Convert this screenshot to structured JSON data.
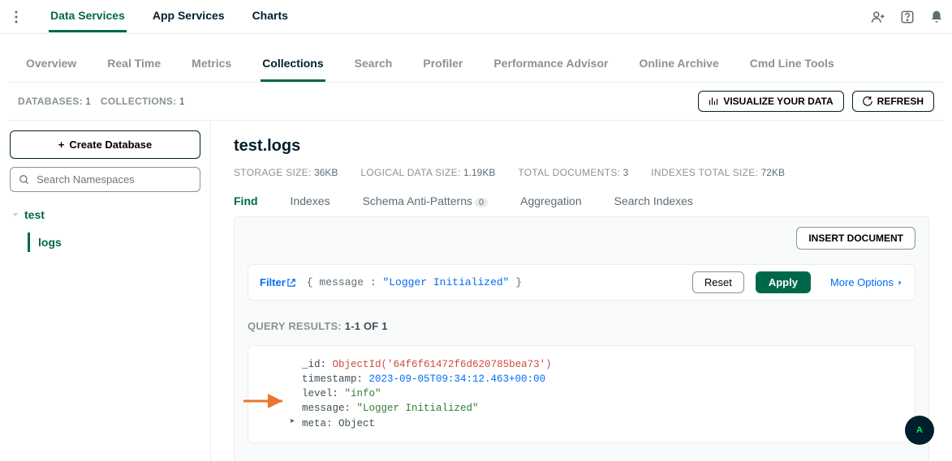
{
  "topnav": {
    "tabs": [
      "Data Services",
      "App Services",
      "Charts"
    ]
  },
  "subnav": [
    "Overview",
    "Real Time",
    "Metrics",
    "Collections",
    "Search",
    "Profiler",
    "Performance Advisor",
    "Online Archive",
    "Cmd Line Tools"
  ],
  "statsbar": {
    "databases_label": "DATABASES:",
    "databases_count": "1",
    "collections_label": "COLLECTIONS:",
    "collections_count": "1",
    "visualize": "VISUALIZE YOUR DATA",
    "refresh": "REFRESH"
  },
  "sidebar": {
    "create": "Create Database",
    "search_placeholder": "Search Namespaces",
    "db": "test",
    "collection": "logs"
  },
  "main": {
    "title": "test.logs",
    "stats": {
      "storage_label": "STORAGE SIZE:",
      "storage_val": "36KB",
      "logical_label": "LOGICAL DATA SIZE:",
      "logical_val": "1.19KB",
      "docs_label": "TOTAL DOCUMENTS:",
      "docs_val": "3",
      "idx_label": "INDEXES TOTAL SIZE:",
      "idx_val": "72KB"
    },
    "coltabs": {
      "find": "Find",
      "indexes": "Indexes",
      "schema": "Schema Anti-Patterns",
      "schema_badge": "0",
      "agg": "Aggregation",
      "search": "Search Indexes"
    },
    "insert": "INSERT DOCUMENT",
    "filter": {
      "label": "Filter",
      "lbr": "{",
      "key": "message :",
      "val": "\"Logger Initialized\"",
      "rbr": "}",
      "reset": "Reset",
      "apply": "Apply",
      "more": "More Options"
    },
    "query_label": "QUERY RESULTS:",
    "query_val": "1-1 OF 1",
    "doc": {
      "id_k": "_id",
      "id_v": "ObjectId('64f6f61472f6d620785bea73')",
      "ts_k": "timestamp",
      "ts_v": "2023-09-05T09:34:12.463+00:00",
      "lvl_k": "level",
      "lvl_v": "\"info\"",
      "msg_k": "message",
      "msg_v": "\"Logger Initialized\"",
      "meta_k": "meta",
      "meta_v": "Object"
    }
  },
  "fab": "A"
}
